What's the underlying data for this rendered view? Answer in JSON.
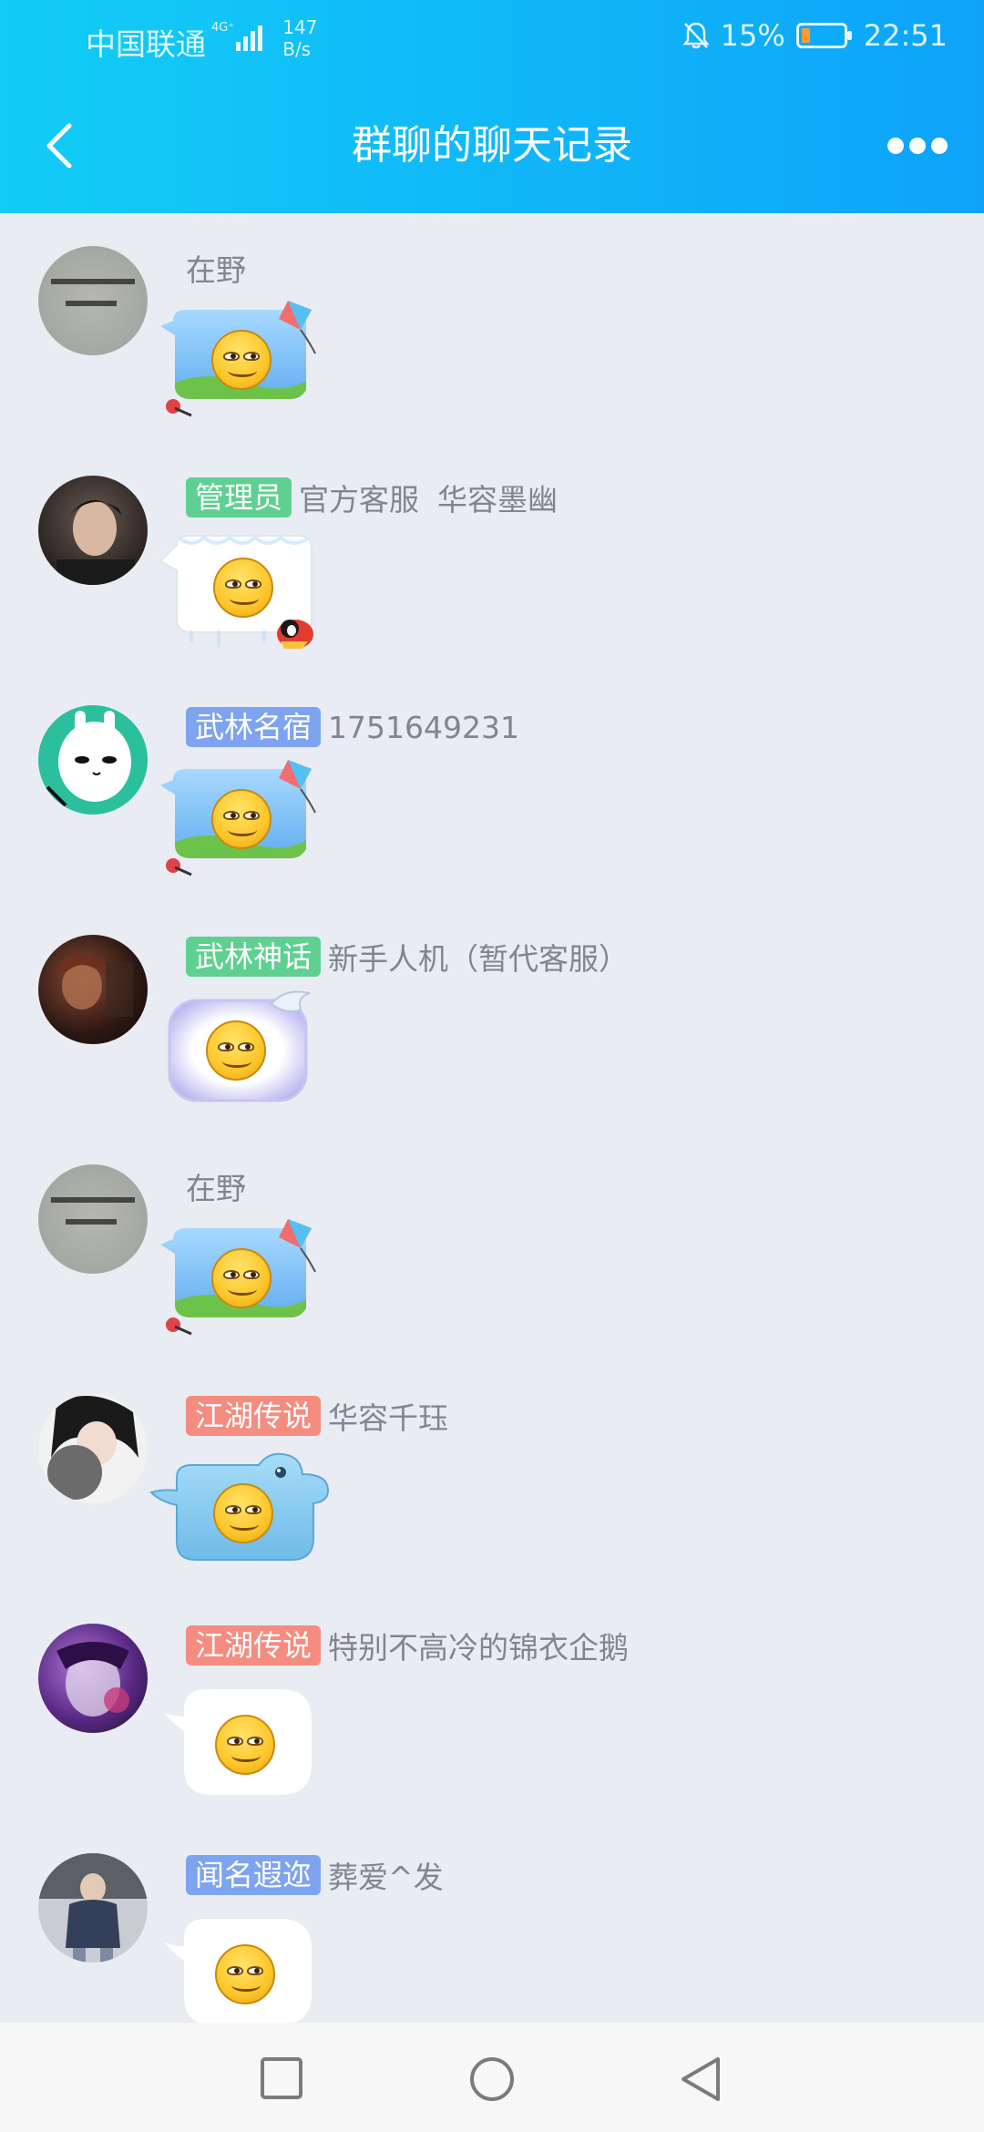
{
  "status_bar": {
    "carrier": "中国联通",
    "network_tag": "4G⁺",
    "net_speed_value": "147",
    "net_speed_unit": "B/s",
    "battery_percent": "15%",
    "time": "22:51"
  },
  "header": {
    "title": "群聊的聊天记录",
    "back_icon": "chevron-left-icon",
    "more_icon": "more-dots-icon"
  },
  "messages": [
    {
      "rank": "",
      "rank_color": "",
      "name": "在野",
      "title_suffix": "",
      "sticker": "blue-kite-bubble-smiley"
    },
    {
      "rank": "管理员",
      "rank_color": "#5fcf92",
      "name": "官方客服",
      "title_suffix": "华容墨幽",
      "sticker": "snow-bubble-smiley"
    },
    {
      "rank": "武林名宿",
      "rank_color": "#7fa4ef",
      "name": "1751649231",
      "title_suffix": "",
      "sticker": "blue-kite-bubble-smiley"
    },
    {
      "rank": "武林神话",
      "rank_color": "#5fcf92",
      "name": "新手人机（暂代客服）",
      "title_suffix": "",
      "sticker": "purple-glow-bubble-smiley"
    },
    {
      "rank": "",
      "rank_color": "",
      "name": "在野",
      "title_suffix": "",
      "sticker": "blue-kite-bubble-smiley"
    },
    {
      "rank": "江湖传说",
      "rank_color": "#f48c7f",
      "name": "华容千珏",
      "title_suffix": "",
      "sticker": "whale-bubble-smiley"
    },
    {
      "rank": "江湖传说",
      "rank_color": "#f48c7f",
      "name": "特别不高冷的锦衣企鹅",
      "title_suffix": "",
      "sticker": "white-bubble-smiley"
    },
    {
      "rank": "闻名遐迩",
      "rank_color": "#7fa4ef",
      "name": "葬爱^发",
      "title_suffix": "",
      "sticker": "white-bubble-smiley"
    }
  ],
  "bottom_nav": {
    "keys": [
      "square-recents-icon",
      "circle-home-icon",
      "triangle-back-icon"
    ]
  },
  "colors": {
    "header_start": "#13cdf6",
    "header_end": "#0ea3f9",
    "background": "#eaecf3"
  }
}
